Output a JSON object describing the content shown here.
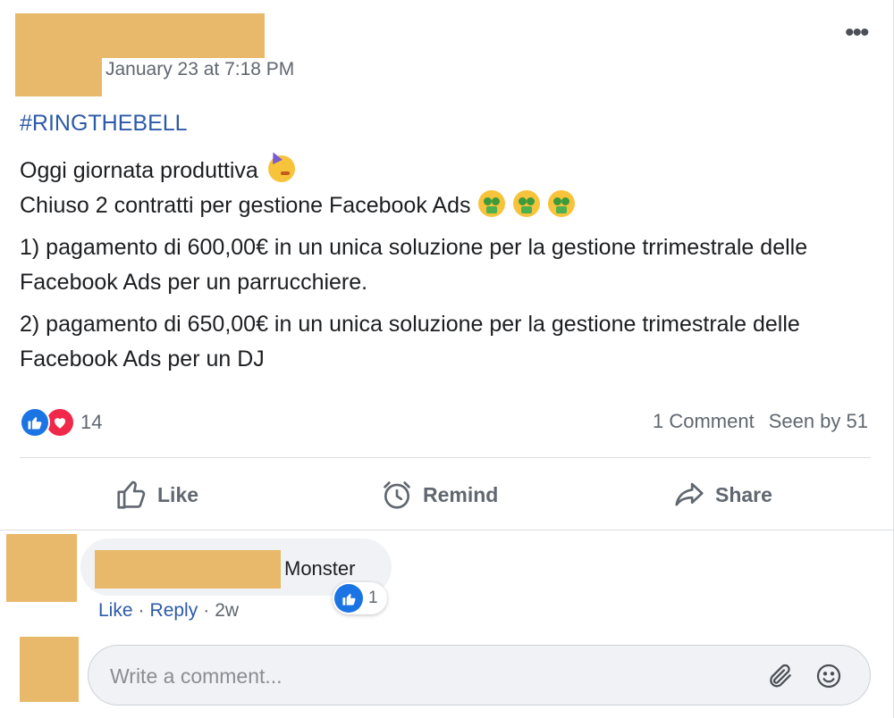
{
  "post": {
    "timestamp": "January 23 at 7:18 PM",
    "hashtag": "#RINGTHEBELL",
    "lines": {
      "line1": "Oggi giornata produttiva",
      "line2": "Chiuso 2 contratti per gestione Facebook Ads",
      "line3": "1) pagamento di 600,00€ in un unica soluzione per la gestione trrimestrale delle Facebook Ads per un parrucchiere.",
      "line4": "2) pagamento di 650,00€ in un unica soluzione per la gestione trimestrale delle Facebook Ads per un DJ"
    },
    "icons": {
      "line1_emoji": "partying-face-icon",
      "line2_emoji": "money-mouth-face-icon",
      "more": "more-options-icon"
    }
  },
  "stats": {
    "reaction_count": "14",
    "comments": "1 Comment",
    "seen_by": "Seen by 51"
  },
  "actions": {
    "like": "Like",
    "remind": "Remind",
    "share": "Share"
  },
  "comment": {
    "text": "Monster",
    "reaction_count": "1",
    "like": "Like",
    "separator": "·",
    "reply": "Reply",
    "time": "2w"
  },
  "composer": {
    "placeholder": "Write a comment..."
  },
  "colors": {
    "redaction": "#e8b96a",
    "link": "#2d5aa8",
    "like_blue": "#1b74e4",
    "love_red": "#f02849"
  }
}
